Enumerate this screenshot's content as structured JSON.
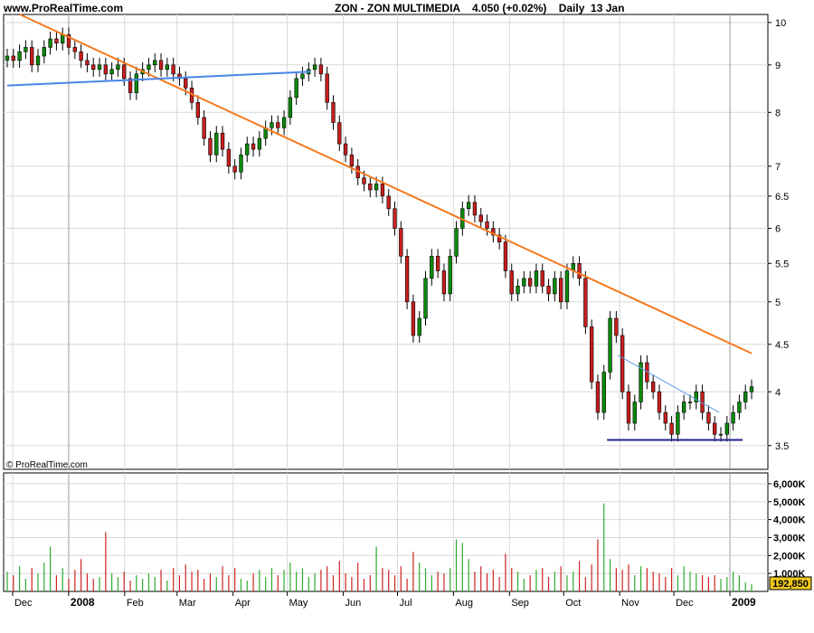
{
  "header": {
    "site": "www.ProRealTime.com",
    "title": "ZON - ZON MULTIMEDIA    4.050 (+0.02%)    Daily  13 Jan"
  },
  "footer": {
    "copyright": "© ProRealTime.com"
  },
  "colors": {
    "background": "#FFFFFF",
    "plot_bg": "#FFFFFF",
    "grid": "#D8D8D8",
    "axis": "#000000",
    "candle_up": "#0A8A0A",
    "candle_down": "#C81E1E",
    "wick": "#000000",
    "trend_orange": "#F47A20",
    "trend_blue": "#4A86E8",
    "trend_navy": "#22228C",
    "trend_light_blue": "#5A9BE8",
    "vol_green": "#2EAA2E",
    "vol_red": "#CC2222",
    "last_vol_bg": "#F0C81E"
  },
  "chart_data": [
    {
      "type": "candlestick",
      "scale": "log",
      "ylim": [
        3.3,
        10.2
      ],
      "y_ticks": [
        3.5,
        4,
        4.5,
        5,
        5.5,
        6,
        6.5,
        7,
        8,
        9,
        10
      ],
      "x_ticks": [
        "Dec",
        "2008",
        "Feb",
        "Mar",
        "Apr",
        "May",
        "Jun",
        "Jul",
        "Aug",
        "Sep",
        "Oct",
        "Nov",
        "Dec",
        "2009"
      ],
      "grid": true,
      "series": [
        {
          "key": "prices",
          "close": [
            9.2,
            9.1,
            9.3,
            9.4,
            9.0,
            9.2,
            9.4,
            9.6,
            9.5,
            9.7,
            9.4,
            9.3,
            9.1,
            9.0,
            8.9,
            9.0,
            8.8,
            8.9,
            9.0,
            8.7,
            8.4,
            8.8,
            8.9,
            9.0,
            9.1,
            8.9,
            9.0,
            8.8,
            8.7,
            8.5,
            8.2,
            7.9,
            7.5,
            7.2,
            7.6,
            7.3,
            7.0,
            6.9,
            7.2,
            7.4,
            7.3,
            7.5,
            7.7,
            7.8,
            7.7,
            7.9,
            8.3,
            8.7,
            8.8,
            8.9,
            9.0,
            8.8,
            8.2,
            7.8,
            7.4,
            7.2,
            7.0,
            6.8,
            6.7,
            6.6,
            6.7,
            6.5,
            6.3,
            6.0,
            5.6,
            5.0,
            4.6,
            4.8,
            5.3,
            5.6,
            5.4,
            5.1,
            5.6,
            6.0,
            6.3,
            6.4,
            6.2,
            6.1,
            6.0,
            5.9,
            5.8,
            5.4,
            5.1,
            5.2,
            5.3,
            5.2,
            5.4,
            5.2,
            5.1,
            5.3,
            5.0,
            5.4,
            5.5,
            5.3,
            4.7,
            4.1,
            3.8,
            4.2,
            4.8,
            4.6,
            4.0,
            3.7,
            3.9,
            4.3,
            4.1,
            4.0,
            3.8,
            3.7,
            3.6,
            3.8,
            3.9,
            3.9,
            4.0,
            3.8,
            3.7,
            3.6,
            3.6,
            3.7,
            3.8,
            3.9,
            4.0,
            4.05
          ]
        },
        {
          "key": "volume_k",
          "values": [
            1100,
            900,
            1400,
            700,
            1300,
            1000,
            1600,
            2500,
            900,
            1300,
            700,
            1200,
            1800,
            1000,
            700,
            800,
            3300,
            1000,
            800,
            1100,
            600,
            900,
            700,
            1000,
            800,
            1200,
            600,
            1300,
            900,
            1500,
            1100,
            1200,
            700,
            1000,
            800,
            1400,
            900,
            1300,
            700,
            600,
            1000,
            1200,
            800,
            1300,
            900,
            1200,
            1600,
            1100,
            1300,
            800,
            1000,
            1200,
            1400,
            900,
            1700,
            1000,
            800,
            1600,
            700,
            900,
            2500,
            1300,
            1200,
            900,
            1400,
            700,
            2200,
            1600,
            1300,
            900,
            1100,
            1000,
            1300,
            2900,
            2700,
            1800,
            1100,
            1400,
            1000,
            1200,
            800,
            2100,
            1300,
            1100,
            700,
            900,
            1200,
            1300,
            800,
            1100,
            1400,
            900,
            1100,
            1700,
            800,
            1500,
            2900,
            4900,
            1800,
            1300,
            1200,
            1500,
            900,
            1400,
            1300,
            1100,
            1000,
            800,
            1300,
            900,
            1400,
            1100,
            1000,
            900,
            800,
            900,
            700,
            800,
            1100,
            900,
            500,
            400
          ]
        }
      ],
      "annotations": [
        {
          "key": "orange_trend",
          "points": [
            [
              "2007-12-05",
              10.2
            ],
            [
              "2009-01-13",
              4.4
            ]
          ]
        },
        {
          "key": "blue_trend",
          "points": [
            [
              "2007-11-28",
              8.55
            ],
            [
              "2008-05-14",
              8.85
            ]
          ]
        },
        {
          "key": "navy_support",
          "points": [
            [
              "2008-10-25",
              3.55
            ],
            [
              "2009-01-08",
              3.55
            ]
          ]
        },
        {
          "key": "light_blue_trend",
          "points": [
            [
              "2008-10-31",
              4.38
            ],
            [
              "2008-12-26",
              3.8
            ]
          ]
        }
      ]
    },
    {
      "type": "bar",
      "ylim": [
        0,
        6600
      ],
      "y_ticks": [
        "1,000K",
        "2,000K",
        "3,000K",
        "4,000K",
        "5,000K",
        "6,000K"
      ],
      "y_tick_values": [
        1000,
        2000,
        3000,
        4000,
        5000,
        6000
      ],
      "last_value": "192,850"
    }
  ]
}
